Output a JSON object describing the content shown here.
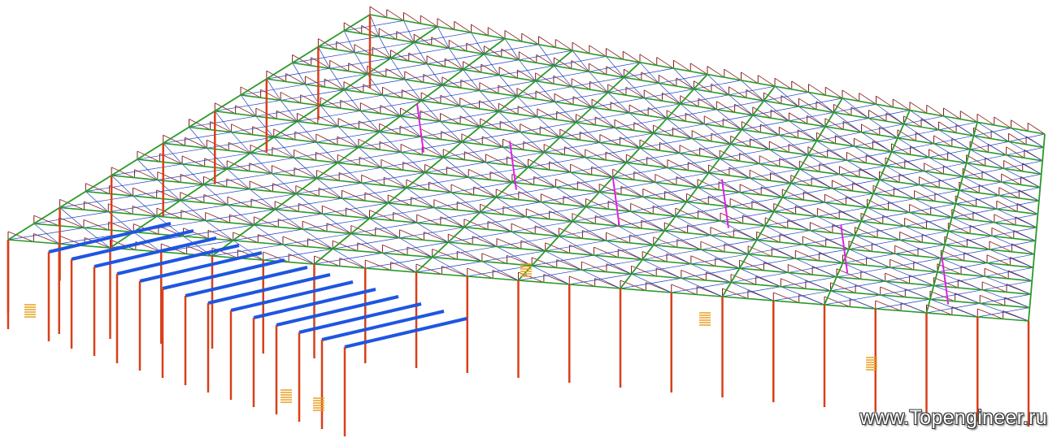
{
  "watermark": {
    "text": "www.Topengineer.ru"
  },
  "colors": {
    "chord": "#2a9a2a",
    "bracing": "#1f3fbf",
    "column": "#d8401a",
    "truss_web": "#8a1b1b",
    "hanger": "#e020e0",
    "floor_beam": "#1e56e0",
    "stair": "#e8a020"
  }
}
